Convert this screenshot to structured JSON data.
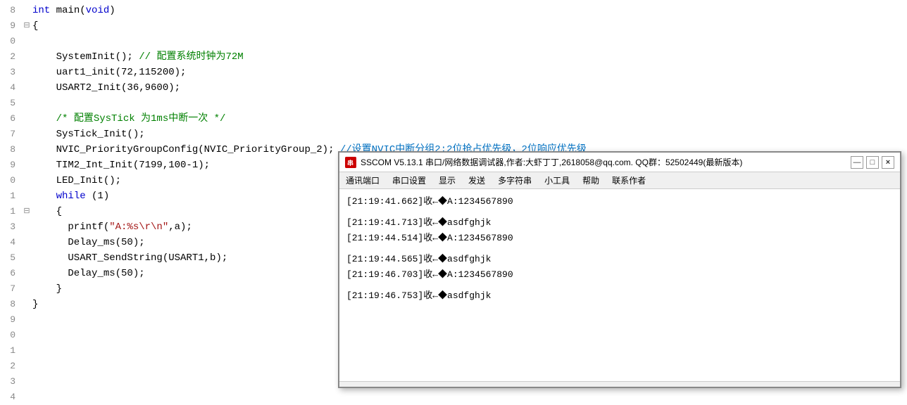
{
  "editor": {
    "lines": [
      {
        "num": "8",
        "marker": "",
        "content_parts": [
          {
            "text": "int ",
            "cls": "kw"
          },
          {
            "text": "main",
            "cls": "plain"
          },
          {
            "text": "(",
            "cls": "plain"
          },
          {
            "text": "void",
            "cls": "kw"
          },
          {
            "text": ")",
            "cls": "plain"
          }
        ]
      },
      {
        "num": "9",
        "marker": "⊟",
        "content_parts": [
          {
            "text": "{",
            "cls": "plain"
          }
        ]
      },
      {
        "num": "0",
        "marker": "",
        "content_parts": []
      },
      {
        "num": "2",
        "marker": "",
        "content_parts": [
          {
            "text": "    SystemInit(); // 配置系统时钟为72M",
            "cls": "comment-inline"
          }
        ]
      },
      {
        "num": "3",
        "marker": "",
        "content_parts": [
          {
            "text": "    uart1_init(72,115200);",
            "cls": "plain"
          }
        ]
      },
      {
        "num": "4",
        "marker": "",
        "content_parts": [
          {
            "text": "    USART2_Init(36,9600);",
            "cls": "plain"
          }
        ]
      },
      {
        "num": "5",
        "marker": "",
        "content_parts": []
      },
      {
        "num": "6",
        "marker": "",
        "content_parts": [
          {
            "text": "    /* 配置SysTick 为1ms中断一次 */",
            "cls": "cm"
          }
        ]
      },
      {
        "num": "7",
        "marker": "",
        "content_parts": [
          {
            "text": "    SysTick_Init();",
            "cls": "plain"
          }
        ]
      },
      {
        "num": "8",
        "marker": "",
        "content_parts": [
          {
            "text": "    NVIC_PriorityGroupConfig(NVIC_PriorityGroup_2); //设置NVIC中断分组2:2位抢占优先级，2位响应优先级",
            "cls": "cm-blue"
          }
        ]
      },
      {
        "num": "9",
        "marker": "",
        "content_parts": [
          {
            "text": "    TIM2_Int_Init(7199,100-1);",
            "cls": "plain"
          }
        ]
      },
      {
        "num": "0",
        "marker": "",
        "content_parts": [
          {
            "text": "    LED_Init();",
            "cls": "plain"
          }
        ]
      },
      {
        "num": "1",
        "marker": "",
        "content_parts": [
          {
            "text": "    ",
            "cls": "plain"
          },
          {
            "text": "while",
            "cls": "kw"
          },
          {
            "text": " (1)",
            "cls": "plain"
          }
        ]
      },
      {
        "num": "1",
        "marker": "⊟",
        "content_parts": [
          {
            "text": "    {",
            "cls": "plain"
          }
        ]
      },
      {
        "num": "3",
        "marker": "",
        "content_parts": [
          {
            "text": "      printf(\"A:%s\\r\\n\",a);",
            "cls": "plain-printf"
          }
        ]
      },
      {
        "num": "4",
        "marker": "",
        "content_parts": [
          {
            "text": "      Delay_ms(50);",
            "cls": "plain"
          }
        ]
      },
      {
        "num": "5",
        "marker": "",
        "content_parts": [
          {
            "text": "      USART_SendString(USART1,b);",
            "cls": "plain"
          }
        ]
      },
      {
        "num": "6",
        "marker": "",
        "content_parts": [
          {
            "text": "      Delay_ms(50);",
            "cls": "plain"
          }
        ]
      },
      {
        "num": "7",
        "marker": "",
        "content_parts": [
          {
            "text": "    }",
            "cls": "plain"
          }
        ]
      },
      {
        "num": "8",
        "marker": "",
        "content_parts": [
          {
            "text": "}",
            "cls": "plain"
          }
        ]
      },
      {
        "num": "9",
        "marker": "",
        "content_parts": []
      },
      {
        "num": "0",
        "marker": "",
        "content_parts": []
      },
      {
        "num": "1",
        "marker": "",
        "content_parts": []
      },
      {
        "num": "2",
        "marker": "",
        "content_parts": []
      },
      {
        "num": "3",
        "marker": "",
        "content_parts": []
      },
      {
        "num": "4",
        "marker": "",
        "content_parts": []
      }
    ]
  },
  "sscom": {
    "title": "SSCOM V5.13.1 串口/网络数据调试器,作者:大虾丁丁,2618058@qq.com. QQ群：52502449(最新版本)",
    "icon_text": "串",
    "menu_items": [
      "通讯端口",
      "串口设置",
      "显示",
      "发送",
      "多字符串",
      "小工具",
      "帮助",
      "联系作者"
    ],
    "title_buttons": [
      "-",
      "□",
      "×"
    ],
    "terminal_lines": [
      {
        "text": "[21:19:41.662]收←◆A:1234567890"
      },
      {
        "text": ""
      },
      {
        "text": "[21:19:41.713]收←◆asdfghjk"
      },
      {
        "text": "[21:19:44.514]收←◆A:1234567890"
      },
      {
        "text": ""
      },
      {
        "text": "[21:19:44.565]收←◆asdfghjk"
      },
      {
        "text": "[21:19:46.703]收←◆A:1234567890"
      },
      {
        "text": ""
      },
      {
        "text": "[21:19:46.753]收←◆asdfghjk"
      }
    ]
  }
}
